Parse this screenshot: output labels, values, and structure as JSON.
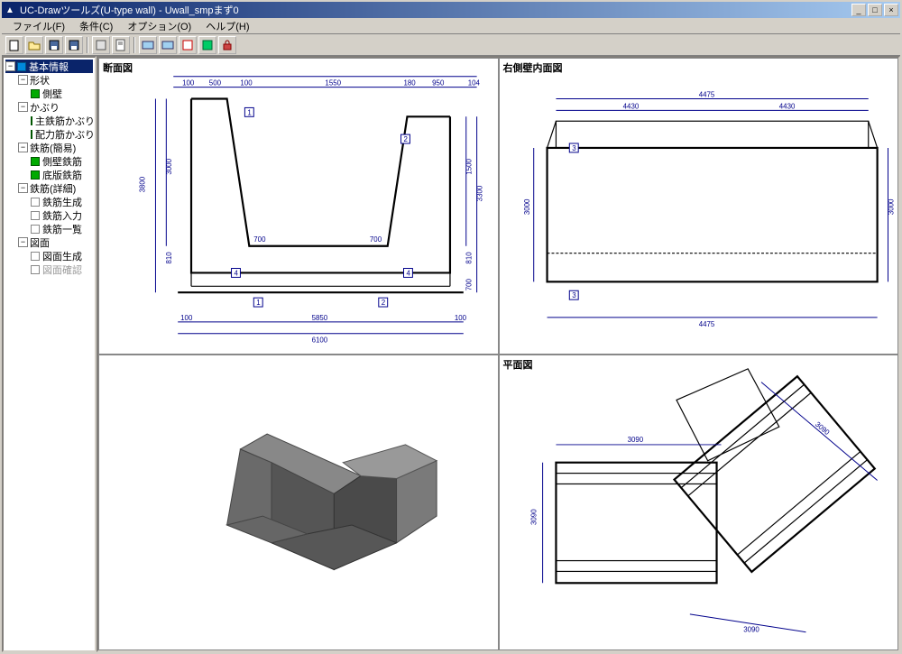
{
  "title": "UC-Drawツールズ(U-type wall) - Uwall_smpまず0",
  "menu": {
    "file": "ファイル(F)",
    "option": "条件(C)",
    "options": "オプション(O)",
    "help": "ヘルプ(H)"
  },
  "views": {
    "tl": "断面図",
    "tr": "右側壁内面図",
    "bl": "",
    "br": "平面図"
  },
  "tree": {
    "root": "基本情報",
    "lvl1": "形状",
    "lvl1a": "側壁",
    "lvl2": "かぶり",
    "lvl2a": "主鉄筋かぶり",
    "lvl2b": "配力筋かぶり",
    "lvl3": "鉄筋(簡易)",
    "lvl3a": "側壁鉄筋",
    "lvl3b": "底版鉄筋",
    "lvl4": "鉄筋(詳細)",
    "lvl4a": "鉄筋生成",
    "lvl4b": "鉄筋入力",
    "lvl4c": "鉄筋一覧",
    "lvl5": "図面",
    "lvl5a": "図面生成",
    "lvl5b": "図面確認"
  },
  "dims": {
    "top_left": "500",
    "top_left2": "100",
    "top_mid": "1550",
    "top_right": "180",
    "top_right2": "950",
    "top_right3": "104",
    "left_h": "3800",
    "left_h2": "3000",
    "bottom_inner": "700",
    "right_h": "3300",
    "right_h2": "1500",
    "bottom_w": "5850",
    "bottom_w2": "6100",
    "mark1": "1",
    "mark2": "2",
    "mark3": "3",
    "mark4": "4",
    "tr_top": "4475",
    "tr_half": "4430",
    "br_dim": "3090",
    "hundred": "100",
    "eightten": "810",
    "seven": "700"
  }
}
